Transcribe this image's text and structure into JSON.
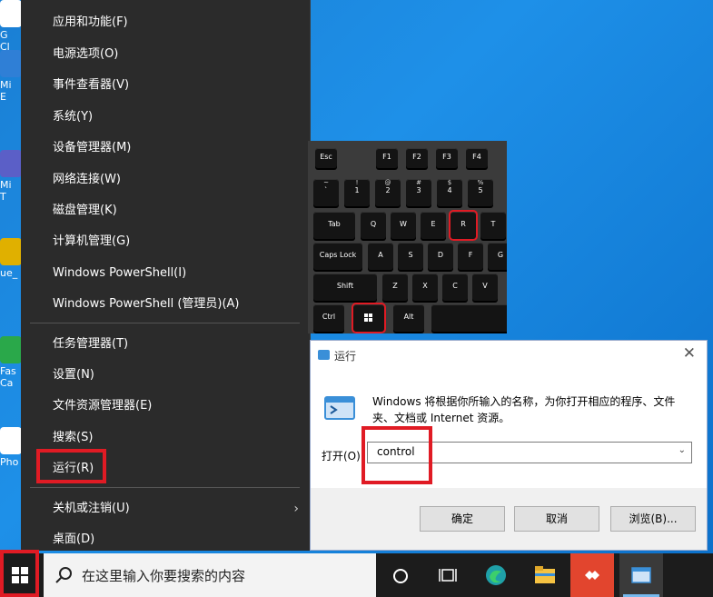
{
  "desktop": {
    "icons": [
      {
        "label": "G\nCl",
        "color": "#ffffff"
      },
      {
        "label": "Mi\nE",
        "color": "#2f7fd6"
      },
      {
        "label": "Mi\nT",
        "color": "#5b5fc7"
      },
      {
        "label": "ue_",
        "color": "#e0b000"
      },
      {
        "label": "Fas\nCa",
        "color": "#2aa84a"
      },
      {
        "label": "Pho",
        "color": "#ffffff"
      }
    ]
  },
  "winx_menu": {
    "items": [
      {
        "label": "应用和功能(F)"
      },
      {
        "label": "电源选项(O)"
      },
      {
        "label": "事件查看器(V)"
      },
      {
        "label": "系统(Y)"
      },
      {
        "label": "设备管理器(M)"
      },
      {
        "label": "网络连接(W)"
      },
      {
        "label": "磁盘管理(K)"
      },
      {
        "label": "计算机管理(G)"
      },
      {
        "label": "Windows PowerShell(I)"
      },
      {
        "label": "Windows PowerShell (管理员)(A)"
      },
      {
        "label": "任务管理器(T)"
      },
      {
        "label": "设置(N)"
      },
      {
        "label": "文件资源管理器(E)"
      },
      {
        "label": "搜索(S)"
      },
      {
        "label": "运行(R)"
      },
      {
        "label": "关机或注销(U)"
      },
      {
        "label": "桌面(D)"
      }
    ]
  },
  "keyboard": {
    "row_fn": [
      "Esc",
      "F1",
      "F2",
      "F3",
      "F4"
    ],
    "row_num": [
      [
        "~",
        "`"
      ],
      [
        "!",
        "1"
      ],
      [
        "@",
        "2"
      ],
      [
        "#",
        "3"
      ],
      [
        "$",
        "4"
      ],
      [
        "%",
        "5"
      ]
    ],
    "tab": "Tab",
    "row_q": [
      "Q",
      "W",
      "E",
      "R",
      "T"
    ],
    "caps": "Caps Lock",
    "row_a": [
      "A",
      "S",
      "D",
      "F",
      "G"
    ],
    "shift": "Shift",
    "row_z": [
      "Z",
      "X",
      "C",
      "V"
    ],
    "ctrl": "Ctrl",
    "alt": "Alt"
  },
  "run_dialog": {
    "title": "运行",
    "close": "✕",
    "description": "Windows 将根据你所输入的名称，为你打开相应的程序、文件夹、文档或 Internet 资源。",
    "open_label": "打开(O):",
    "value": "control",
    "ok": "确定",
    "cancel": "取消",
    "browse": "浏览(B)..."
  },
  "taskbar": {
    "search_placeholder": "在这里输入你要搜索的内容"
  },
  "colors": {
    "highlight": "#e01b24",
    "menu_bg": "#2b2b2b",
    "desktop": "#1e90e8"
  }
}
